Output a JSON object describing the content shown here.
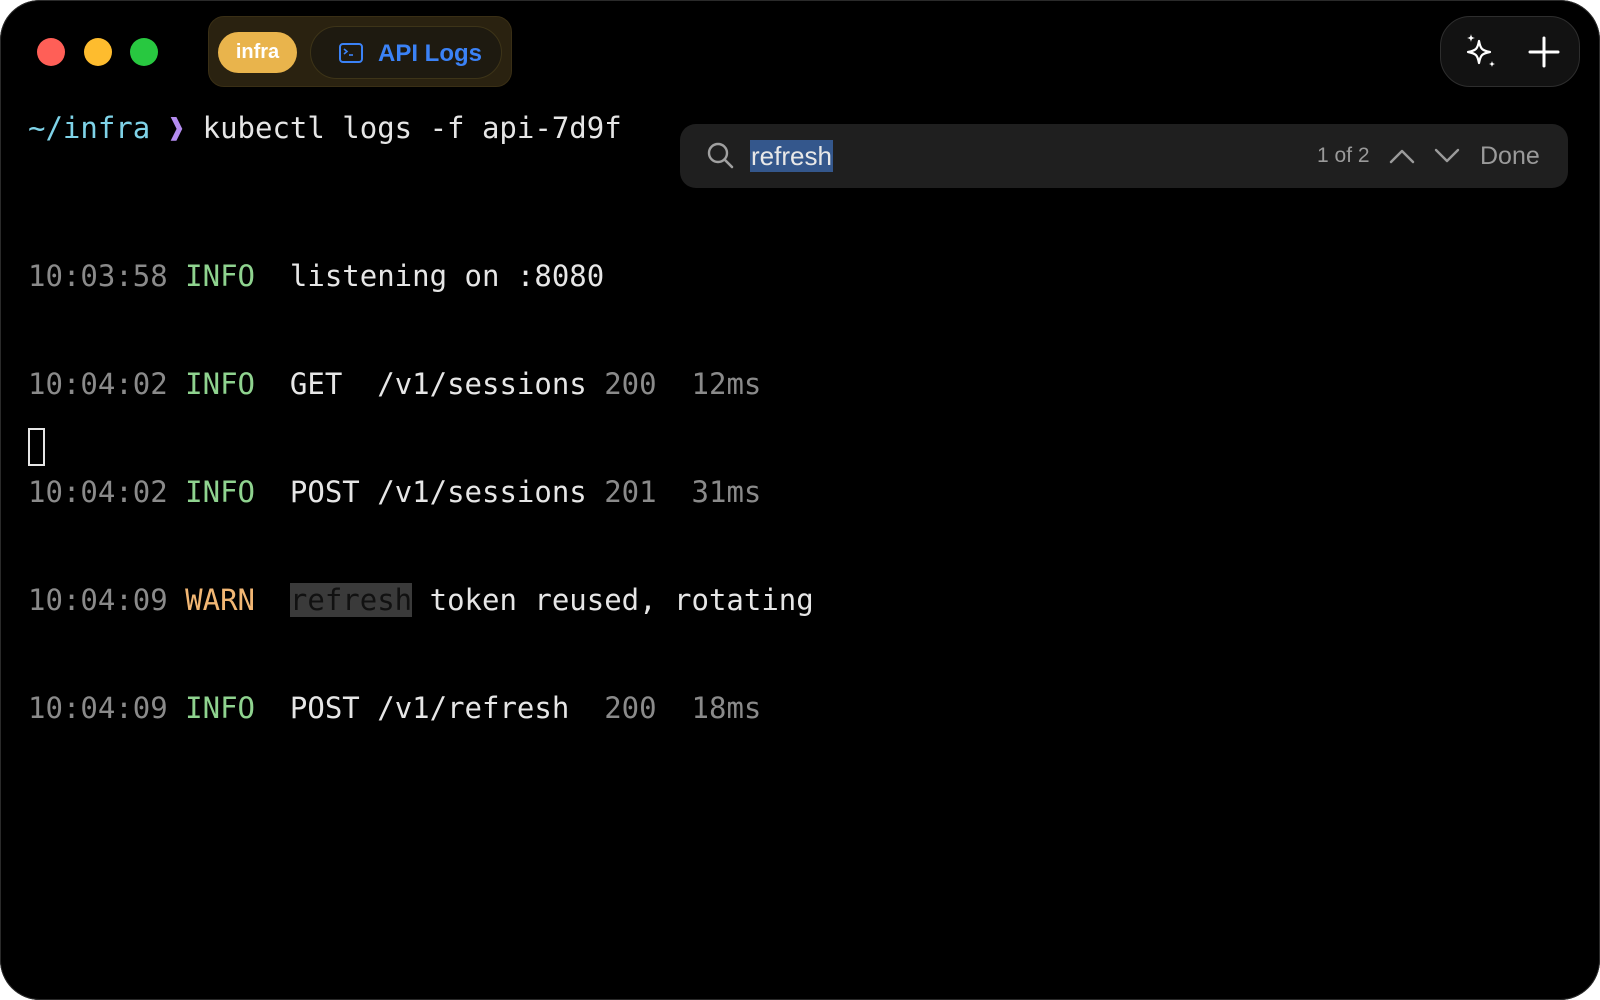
{
  "window": {
    "traffic_lights": [
      "close",
      "minimize",
      "maximize"
    ]
  },
  "tab_group": {
    "label": "infra",
    "color": "#e9b44c"
  },
  "tab": {
    "icon": "terminal-icon",
    "title": "API Logs",
    "color": "#3b82f6"
  },
  "toolbar": {
    "ai_icon": "sparkles-icon",
    "add_icon": "plus-icon"
  },
  "prompt": {
    "path": "~/infra",
    "arrow": "❱",
    "command": "kubectl logs -f api-7d9f"
  },
  "logs": [
    {
      "time": "10:03:58",
      "level": "INFO",
      "message": "listening on :8080"
    },
    {
      "time": "10:04:02",
      "level": "INFO",
      "method": "GET ",
      "path": "/v1/sessions",
      "status": "200",
      "duration": "12ms"
    },
    {
      "time": "10:04:02",
      "level": "INFO",
      "method": "POST",
      "path": "/v1/sessions",
      "status": "201",
      "duration": "31ms"
    },
    {
      "time": "10:04:09",
      "level": "WARN",
      "match": "refresh",
      "message": "token reused, rotating"
    },
    {
      "time": "10:04:09",
      "level": "INFO",
      "method": "POST",
      "path": "/v1/refresh ",
      "status": "200",
      "duration": "18ms"
    }
  ],
  "find": {
    "query": "refresh",
    "match_count": "1 of 2",
    "done_label": "Done",
    "search_icon": "search-icon",
    "prev_icon": "chevron-up-icon",
    "next_icon": "chevron-down-icon"
  }
}
